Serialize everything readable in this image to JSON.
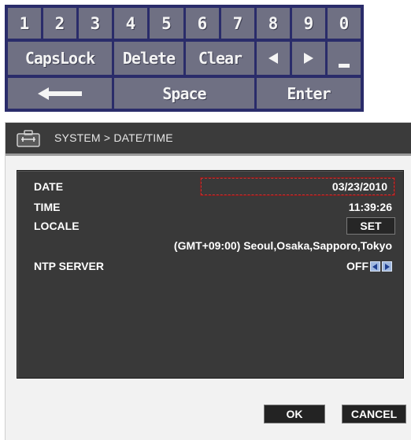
{
  "keyboard": {
    "row1": [
      "1",
      "2",
      "3",
      "4",
      "5",
      "6",
      "7",
      "8",
      "9",
      "0"
    ],
    "caps_lock": "CapsLock",
    "delete": "Delete",
    "clear": "Clear",
    "space": "Space",
    "enter": "Enter",
    "left_arrow_icon": "left-triangle-icon",
    "right_arrow_icon": "right-triangle-icon",
    "underscore_icon": "underscore-icon",
    "backspace_icon": "left-arrow-icon"
  },
  "dialog": {
    "title": "SYSTEM > DATE/TIME",
    "title_icon": "system-toolbox-icon",
    "fields": {
      "date_label": "DATE",
      "date_value": "03/23/2010",
      "time_label": "TIME",
      "time_value": "11:39:26",
      "locale_label": "LOCALE",
      "locale_button": "SET",
      "locale_value": "(GMT+09:00) Seoul,Osaka,Sapporo,Tokyo",
      "ntp_label": "NTP SERVER",
      "ntp_value": "OFF"
    },
    "ok_label": "OK",
    "cancel_label": "CANCEL"
  },
  "colors": {
    "keyboard_bg": "#2a2c6a",
    "key_bg": "#6f7083",
    "panel_bg": "#393939",
    "titlebar_bg": "#3b3b3b",
    "focus_border": "#c83030",
    "ntp_arrow_bg": "#9fb7de"
  }
}
